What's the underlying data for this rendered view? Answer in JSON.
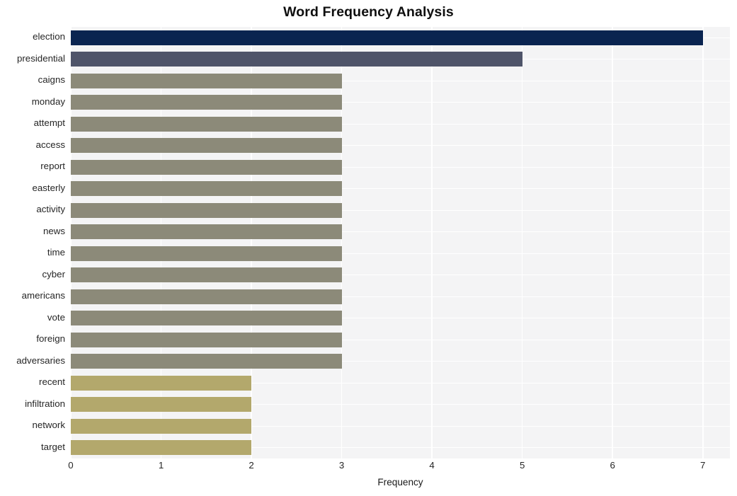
{
  "chart_data": {
    "type": "bar",
    "orientation": "horizontal",
    "title": "Word Frequency Analysis",
    "xlabel": "Frequency",
    "ylabel": "",
    "xlim": [
      0,
      7.3
    ],
    "xticks": [
      0,
      1,
      2,
      3,
      4,
      5,
      6,
      7
    ],
    "xtick_labels": [
      "0",
      "1",
      "2",
      "3",
      "4",
      "5",
      "6",
      "7"
    ],
    "grid": true,
    "legend": false,
    "categories": [
      "election",
      "presidential",
      "caigns",
      "monday",
      "attempt",
      "access",
      "report",
      "easterly",
      "activity",
      "news",
      "time",
      "cyber",
      "americans",
      "vote",
      "foreign",
      "adversaries",
      "recent",
      "infiltration",
      "network",
      "target"
    ],
    "values": [
      7,
      5,
      3,
      3,
      3,
      3,
      3,
      3,
      3,
      3,
      3,
      3,
      3,
      3,
      3,
      3,
      2,
      2,
      2,
      2
    ],
    "bar_colors": [
      "#0a2450",
      "#4f5469",
      "#8c8a79",
      "#8c8a79",
      "#8c8a79",
      "#8c8a79",
      "#8c8a79",
      "#8c8a79",
      "#8c8a79",
      "#8c8a79",
      "#8c8a79",
      "#8c8a79",
      "#8c8a79",
      "#8c8a79",
      "#8c8a79",
      "#8c8a79",
      "#b3a86c",
      "#b3a86c",
      "#b3a86c",
      "#b3a86c"
    ],
    "plot_background": "#f4f4f5",
    "grid_color": "#ffffff",
    "figure_background": "#ffffff"
  }
}
